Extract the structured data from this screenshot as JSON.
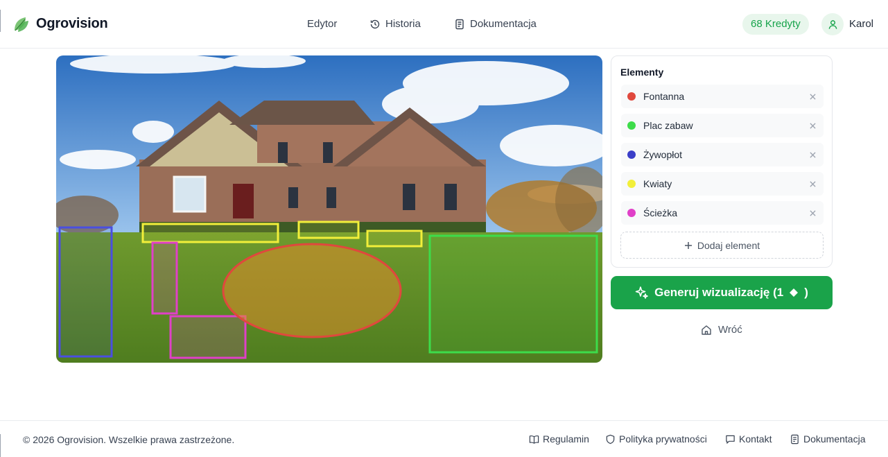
{
  "header": {
    "brand": "Ogrovision",
    "nav": [
      {
        "label": "Edytor",
        "icon": "none"
      },
      {
        "label": "Historia",
        "icon": "history-icon"
      },
      {
        "label": "Dokumentacja",
        "icon": "document-icon"
      }
    ],
    "credits": "68 Kredyty",
    "user": "Karol"
  },
  "panel": {
    "title": "Elementy",
    "items": [
      {
        "label": "Fontanna",
        "color": "#e0483d"
      },
      {
        "label": "Plac zabaw",
        "color": "#3ddc4a"
      },
      {
        "label": "Żywopłot",
        "color": "#3b3fc8"
      },
      {
        "label": "Kwiaty",
        "color": "#f2ef3a"
      },
      {
        "label": "Ścieżka",
        "color": "#e040c8"
      }
    ],
    "add_label": "Dodaj element"
  },
  "generate": {
    "label": "Generuj wizualizację (1",
    "suffix": ")"
  },
  "back_label": "Wróć",
  "footer": {
    "copyright": "© 2026 Ogrovision. Wszelkie prawa zastrzeżone.",
    "links": [
      {
        "label": "Regulamin",
        "icon": "book-icon"
      },
      {
        "label": "Polityka prywatności",
        "icon": "shield-icon"
      },
      {
        "label": "Kontakt",
        "icon": "message-icon"
      },
      {
        "label": "Dokumentacja",
        "icon": "document-icon"
      }
    ]
  },
  "colors": {
    "accent": "#1aa34a",
    "credits_bg": "#e8f6ec"
  }
}
